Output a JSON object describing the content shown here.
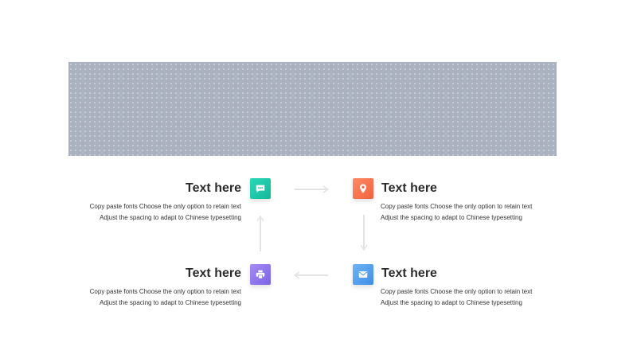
{
  "banner": {
    "color": "#aab2c0"
  },
  "items": [
    {
      "title": "Text here",
      "line1": "Copy paste fonts Choose the only option to retain text",
      "line2": "Adjust the spacing to adapt to Chinese typesetting",
      "icon": "chat-icon",
      "color_from": "#2ad8b8",
      "color_to": "#15b89a"
    },
    {
      "title": "Text here",
      "line1": "Copy paste fonts Choose the only option to retain text",
      "line2": "Adjust the spacing to adapt to Chinese typesetting",
      "icon": "location-pin-icon",
      "color_from": "#ff8a65",
      "color_to": "#f0623e"
    },
    {
      "title": "Text here",
      "line1": "Copy paste fonts Choose the only option to retain text",
      "line2": "Adjust the spacing to adapt to Chinese typesetting",
      "icon": "printer-icon",
      "color_from": "#a68cf5",
      "color_to": "#7a62e6"
    },
    {
      "title": "Text here",
      "line1": "Copy paste fonts Choose the only option to retain text",
      "line2": "Adjust the spacing to adapt to Chinese typesetting",
      "icon": "mail-icon",
      "color_from": "#6fb3f5",
      "color_to": "#3f8ee6"
    }
  ],
  "arrow_color": "#e3e3e3"
}
